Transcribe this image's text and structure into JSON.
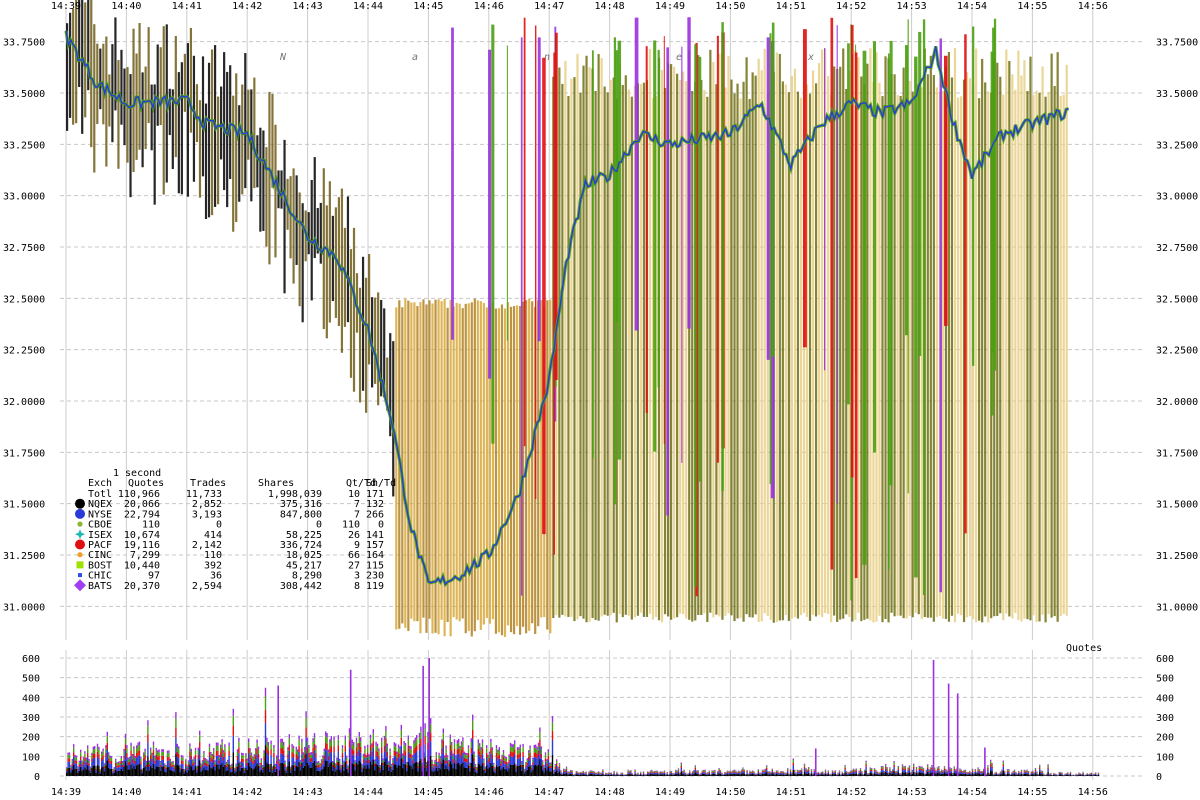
{
  "chart_data": [
    {
      "type": "line",
      "time_labels": [
        "14:39",
        "14:40",
        "14:41",
        "14:42",
        "14:43",
        "14:44",
        "14:45",
        "14:46",
        "14:47",
        "14:48",
        "14:49",
        "14:50",
        "14:51",
        "14:52",
        "14:53",
        "14:54",
        "14:55",
        "14:56"
      ],
      "ylim": [
        30.875,
        33.875
      ],
      "y_ticks": [
        "31.0000",
        "31.2500",
        "31.5000",
        "31.7500",
        "32.0000",
        "32.2500",
        "32.5000",
        "32.7500",
        "33.0000",
        "33.2500",
        "33.5000",
        "33.7500"
      ],
      "y_tick_values": [
        31.0,
        31.25,
        31.5,
        31.75,
        32.0,
        32.25,
        32.5,
        32.75,
        33.0,
        33.25,
        33.5,
        33.75
      ],
      "grid": true,
      "watermark": [
        "N",
        "a",
        "n",
        "e",
        "x"
      ],
      "price_trace": [
        [
          0,
          33.78
        ],
        [
          0.5,
          33.55
        ],
        [
          1,
          33.45
        ],
        [
          2,
          33.46
        ],
        [
          2.3,
          33.35
        ],
        [
          3,
          33.3
        ],
        [
          3.5,
          33.05
        ],
        [
          4,
          32.8
        ],
        [
          4.5,
          32.7
        ],
        [
          5,
          32.35
        ],
        [
          5.4,
          31.9
        ],
        [
          5.7,
          31.4
        ],
        [
          6,
          31.1
        ],
        [
          6.5,
          31.15
        ],
        [
          7,
          31.25
        ],
        [
          7.5,
          31.55
        ],
        [
          8,
          32.1
        ],
        [
          8.3,
          32.7
        ],
        [
          8.6,
          33.05
        ],
        [
          9,
          33.1
        ],
        [
          9.5,
          33.3
        ],
        [
          10,
          33.25
        ],
        [
          11,
          33.3
        ],
        [
          11.5,
          33.45
        ],
        [
          12,
          33.15
        ],
        [
          12.5,
          33.35
        ],
        [
          13,
          33.45
        ],
        [
          13.5,
          33.4
        ],
        [
          14,
          33.45
        ],
        [
          14.4,
          33.7
        ],
        [
          14.7,
          33.35
        ],
        [
          15,
          33.1
        ],
        [
          15.5,
          33.3
        ],
        [
          16,
          33.35
        ],
        [
          16.5,
          33.4
        ]
      ],
      "series_colors": {
        "nqex": "#000000",
        "nyse": "#2a3ad8",
        "pacf": "#e01010",
        "bost": "#4aa012",
        "bats": "#9a30e0",
        "cinc": "#dca838",
        "chic": "#707010",
        "cboe": "#8ab830"
      },
      "legend": {
        "title": "1 second",
        "headers": [
          "Exch",
          "Quotes",
          "Trades",
          "Shares",
          "Qt/Td",
          "Sh/Td"
        ],
        "rows": [
          {
            "exch": "Totl",
            "quotes": "110,966",
            "trades": "11,733",
            "shares": "1,998,039",
            "qt_td": "10",
            "sh_td": "171",
            "marker": "none",
            "color": ""
          },
          {
            "exch": "NQEX",
            "quotes": "20,066",
            "trades": "2,852",
            "shares": "375,316",
            "qt_td": "7",
            "sh_td": "132",
            "marker": "circle-lg",
            "color": "#000000"
          },
          {
            "exch": "NYSE",
            "quotes": "22,794",
            "trades": "3,193",
            "shares": "847,800",
            "qt_td": "7",
            "sh_td": "266",
            "marker": "circle-lg",
            "color": "#2a3ad8"
          },
          {
            "exch": "CBOE",
            "quotes": "110",
            "trades": "0",
            "shares": "0",
            "qt_td": "110",
            "sh_td": "0",
            "marker": "circle-sm",
            "color": "#8ab830"
          },
          {
            "exch": "ISEX",
            "quotes": "10,674",
            "trades": "414",
            "shares": "58,225",
            "qt_td": "26",
            "sh_td": "141",
            "marker": "star",
            "color": "#20b8b0"
          },
          {
            "exch": "PACF",
            "quotes": "19,116",
            "trades": "2,142",
            "shares": "336,724",
            "qt_td": "9",
            "sh_td": "157",
            "marker": "circle-lg",
            "color": "#e01010"
          },
          {
            "exch": "CINC",
            "quotes": "7,299",
            "trades": "110",
            "shares": "18,025",
            "qt_td": "66",
            "sh_td": "164",
            "marker": "circle-sm",
            "color": "#f0a020"
          },
          {
            "exch": "BOST",
            "quotes": "10,440",
            "trades": "392",
            "shares": "45,217",
            "qt_td": "27",
            "sh_td": "115",
            "marker": "square",
            "color": "#a0e000"
          },
          {
            "exch": "CHIC",
            "quotes": "97",
            "trades": "36",
            "shares": "8,290",
            "qt_td": "3",
            "sh_td": "230",
            "marker": "square-sm",
            "color": "#3050e0"
          },
          {
            "exch": "BATS",
            "quotes": "20,370",
            "trades": "2,594",
            "shares": "308,442",
            "qt_td": "8",
            "sh_td": "119",
            "marker": "diamond",
            "color": "#a040f0"
          }
        ]
      }
    },
    {
      "type": "bar",
      "label": "Quotes",
      "ylim": [
        0,
        600
      ],
      "y_ticks": [
        "0",
        "100",
        "200",
        "300",
        "400",
        "500",
        "600"
      ],
      "y_tick_values": [
        0,
        100,
        200,
        300,
        400,
        500,
        600
      ],
      "grid": true,
      "profile": [
        [
          0,
          110
        ],
        [
          1,
          120
        ],
        [
          2,
          115
        ],
        [
          3,
          135
        ],
        [
          4,
          150
        ],
        [
          5,
          170
        ],
        [
          5.5,
          175
        ],
        [
          6,
          200
        ],
        [
          6.5,
          140
        ],
        [
          7,
          130
        ],
        [
          8,
          110
        ],
        [
          8.3,
          25
        ],
        [
          9,
          22
        ],
        [
          10,
          22
        ],
        [
          11,
          22
        ],
        [
          12,
          28
        ],
        [
          13,
          25
        ],
        [
          14,
          45
        ],
        [
          15,
          30
        ],
        [
          16,
          22
        ],
        [
          16.5,
          15
        ]
      ],
      "spikes": [
        [
          14.35,
          590
        ],
        [
          14.6,
          470
        ],
        [
          14.75,
          420
        ],
        [
          6.0,
          600
        ],
        [
          5.9,
          560
        ],
        [
          4.7,
          540
        ],
        [
          3.5,
          460
        ],
        [
          12.4,
          140
        ],
        [
          15.2,
          145
        ]
      ]
    }
  ]
}
